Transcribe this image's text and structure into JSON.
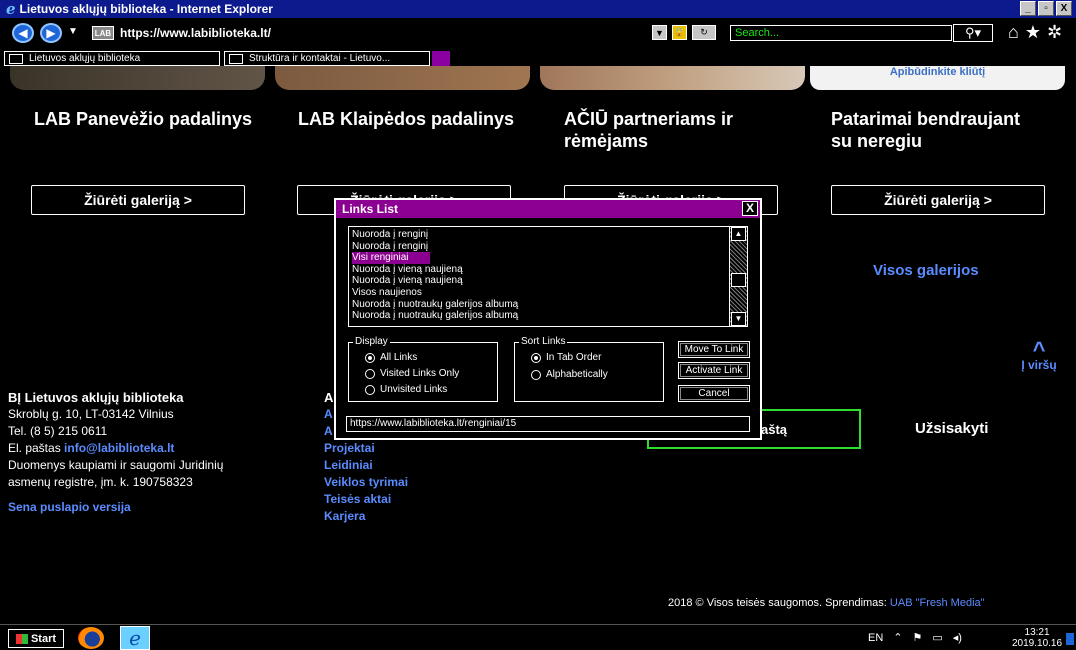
{
  "window": {
    "title": "Lietuvos aklųjų biblioteka - Internet Explorer",
    "controls": [
      "_",
      "▫",
      "X"
    ]
  },
  "browser": {
    "url": "https://www.labiblioteka.lt/",
    "search_placeholder": "Search...",
    "tabs": [
      {
        "label": "Lietuvos aklųjų biblioteka"
      },
      {
        "label": "Struktūra ir kontaktai - Lietuvo..."
      }
    ]
  },
  "galleries": [
    {
      "title": "LAB Panevėžio padalinys",
      "button": "Žiūrėti galeriją >"
    },
    {
      "title": "LAB Klaipėdos padalinys",
      "button": "Žiūrėti galeriją >"
    },
    {
      "title": "AČIŪ partneriams ir rėmėjams",
      "button": "Žiūrėti galeriją >"
    },
    {
      "title": "Patarimai bendraujant su neregiu",
      "button": "Žiūrėti galeriją >"
    }
  ],
  "banner_text": "Apibūdinkite kliūtį",
  "all_galleries": "Visos galerijos",
  "scroll_top": "Į viršų",
  "footer": {
    "org": "BĮ Lietuvos aklųjų biblioteka",
    "address": "Skroblų g. 10, LT-03142 Vilnius",
    "phone": "Tel. (8 5) 215 0611",
    "email_label": "El. paštas",
    "email": "info@labiblioteka.lt",
    "registry_1": "Duomenys kaupiami ir saugomi Juridinių",
    "registry_2": "asmenų registre, įm. k. 190758323",
    "old_version": "Sena puslapio versija",
    "menu_head": "A",
    "menu": [
      "A",
      "A",
      "Projektai",
      "Leidiniai",
      "Veiklos tyrimai",
      "Teisės aktai",
      "Karjera"
    ],
    "email_button": "aštą",
    "subscribe": "Užsisakyti",
    "copyright": "2018 © Visos teisės saugomos. Sprendimas:",
    "developer": "UAB \"Fresh Media\""
  },
  "dialog": {
    "title": "Links List",
    "close": "X",
    "links": [
      "Nuoroda į renginį",
      "Nuoroda į renginį",
      "Visi renginiai",
      "Nuoroda į vieną naujieną",
      "Nuoroda į vieną naujieną",
      "Visos naujienos",
      "Nuoroda į nuotraukų galerijos albumą",
      "Nuoroda į nuotraukų galerijos albumą"
    ],
    "selected_index": 2,
    "display_label": "Display",
    "display_options": [
      "All Links",
      "Visited Links Only",
      "Unvisited Links"
    ],
    "display_selected": 0,
    "sort_label": "Sort Links",
    "sort_options": [
      "In Tab Order",
      "Alphabetically"
    ],
    "sort_selected": 0,
    "buttons": {
      "move": "Move To Link",
      "activate": "Activate Link",
      "cancel": "Cancel"
    },
    "url": "https://www.labiblioteka.lt/renginiai/15"
  },
  "taskbar": {
    "start": "Start",
    "lang": "EN",
    "time": "13:21",
    "date": "2019.10.16"
  }
}
